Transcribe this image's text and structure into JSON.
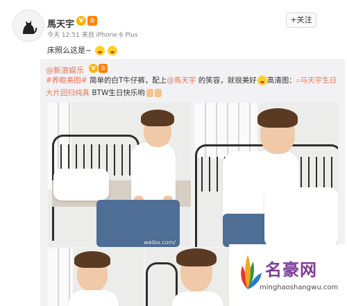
{
  "header": {
    "username": "馬天宇",
    "verified_badge": "V",
    "member_icon": "会",
    "time": "今天 12:51",
    "source": "来自 iPhone 6 Plus",
    "follow_label": "+关注"
  },
  "post": {
    "text": "床照么这是~"
  },
  "repost": {
    "user": "@新浪娱乐",
    "verified_badge": "V",
    "member_icon": "会",
    "tag1": "#养眼美图#",
    "text1": " 简单的白T牛仔裤，配上",
    "mention": "@馬天宇",
    "text2": " 的笑容，就很美好",
    "text3": "高清图：",
    "topic": "马天宇生日大片回归纯真",
    "text4": " BTW生日快乐哟"
  },
  "photos": {
    "watermark": "weibo.com/"
  },
  "site_logo": {
    "name": "名豪网",
    "url": "minghaoshangwu.com"
  },
  "colors": {
    "orange_link": "#eb7350",
    "badge": "#f7b500",
    "logo_purple": "#7d3d96",
    "repost_bg": "#f2f2f5"
  }
}
